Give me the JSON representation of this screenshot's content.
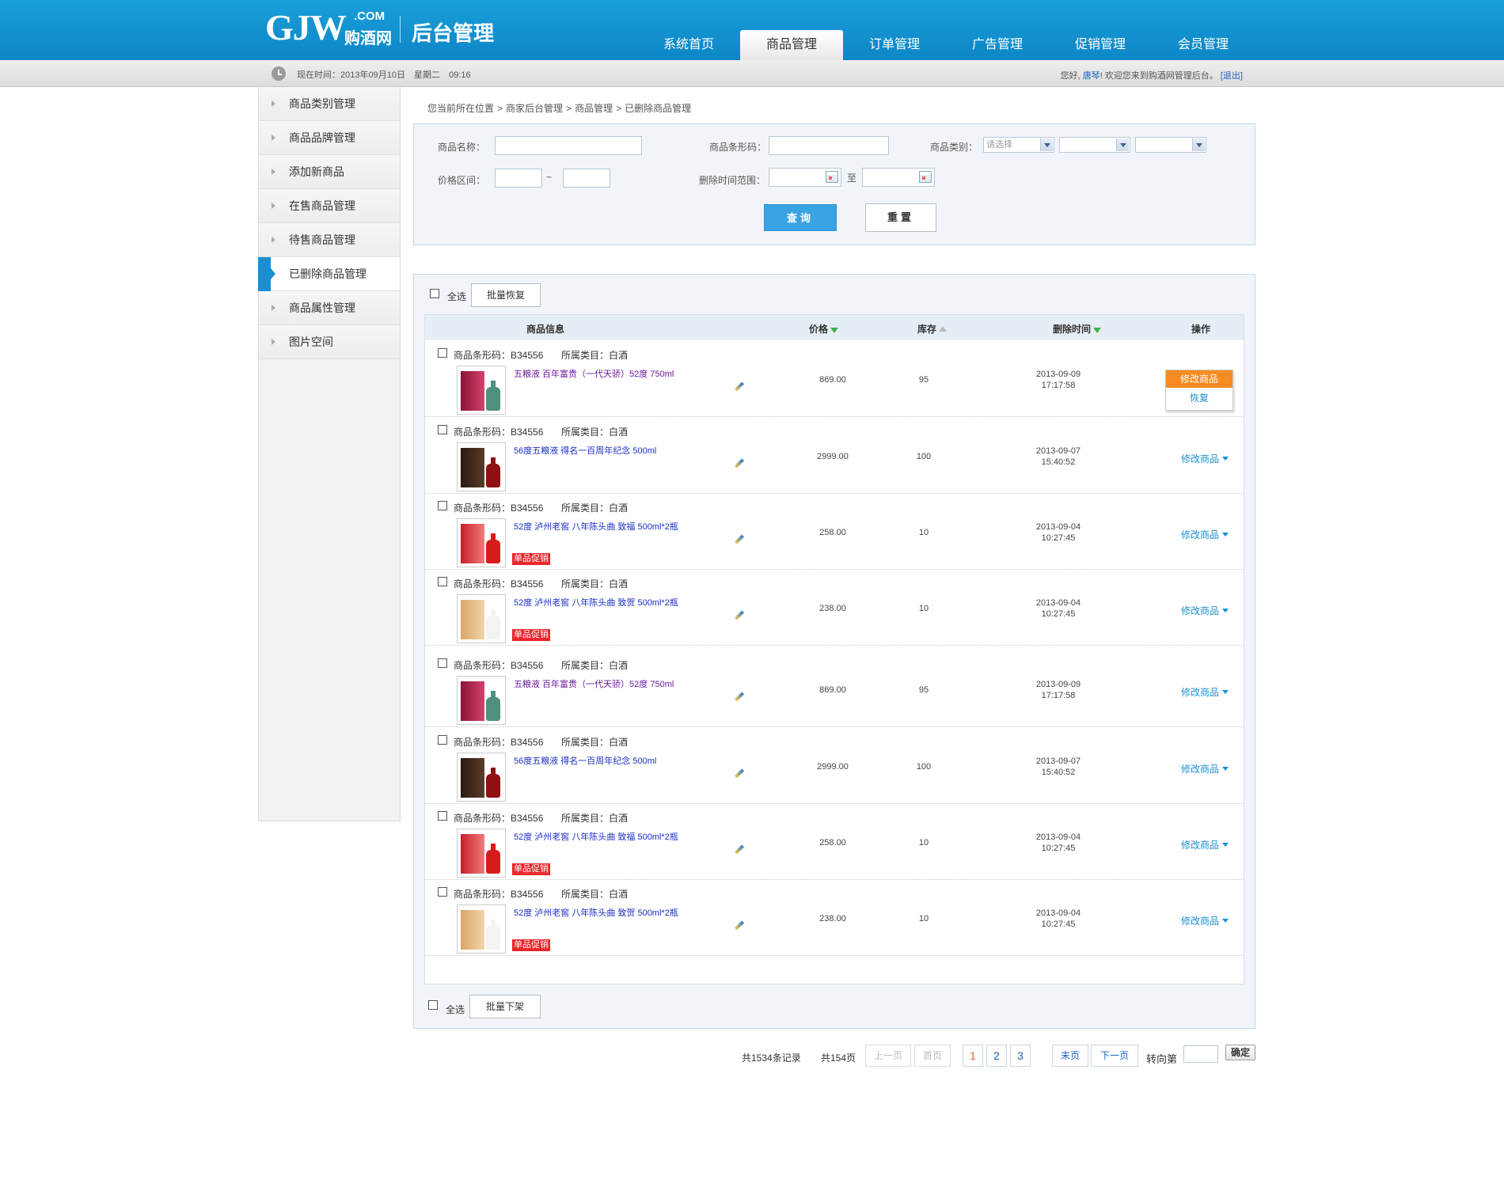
{
  "header": {
    "logo_text": "GJW",
    "logo_com": ".COM",
    "logo_cn": "购酒网",
    "admin_title": "后台管理",
    "nav": [
      {
        "label": "系统首页",
        "active": false
      },
      {
        "label": "商品管理",
        "active": true
      },
      {
        "label": "订单管理",
        "active": false
      },
      {
        "label": "广告管理",
        "active": false
      },
      {
        "label": "促销管理",
        "active": false
      },
      {
        "label": "会员管理",
        "active": false
      }
    ]
  },
  "subbar": {
    "time_label": "现在时间：2013年09月10日",
    "weekday": "星期二",
    "clock": "09:16",
    "greeting": "您好,",
    "username": "唐琴",
    "welcome": "! 欢迎您来到购酒网管理后台。",
    "logout": "[退出]"
  },
  "sidebar": {
    "items": [
      {
        "label": "商品类别管理",
        "active": false
      },
      {
        "label": "商品品牌管理",
        "active": false
      },
      {
        "label": "添加新商品",
        "active": false
      },
      {
        "label": "在售商品管理",
        "active": false
      },
      {
        "label": "待售商品管理",
        "active": false
      },
      {
        "label": "已删除商品管理",
        "active": true
      },
      {
        "label": "商品属性管理",
        "active": false
      },
      {
        "label": "图片空间",
        "active": false
      }
    ]
  },
  "breadcrumb": [
    "您当前所在位置",
    ">",
    "商家后台管理",
    ">",
    "商品管理",
    ">",
    "已删除商品管理"
  ],
  "search": {
    "name_label": "商品名称：",
    "barcode_label": "商品条形码：",
    "category_label": "商品类别：",
    "category_placeholder": "请选择",
    "price_label": "价格区间：",
    "price_sep": "~",
    "deltime_label": "删除时间范围：",
    "deltime_sep": "至",
    "query_button": "查询",
    "reset_button": "重置"
  },
  "list": {
    "select_all": "全选",
    "batch_restore": "批量恢复",
    "batch_offshelf": "批量下架",
    "headers": {
      "info": "商品信息",
      "price": "价格",
      "stock": "库存",
      "deltime": "删除时间",
      "action": "操作"
    },
    "op_label": "修改商品",
    "op_menu_edit": "修改商品",
    "op_menu_restore": "恢复",
    "promo_label": "单品促销",
    "rows": [
      {
        "code": "商品条形码：B34556",
        "cat": "所属类目：白酒",
        "name": "五粮液 百年富贵（一代天骄）52度 750ml",
        "price": "869.00",
        "stock": "95",
        "date": "2013-09-09",
        "time": "17:17:58",
        "promo": false,
        "visited": true,
        "menu_open": true,
        "img": "wly-red"
      },
      {
        "code": "商品条形码：B34556",
        "cat": "所属类目：白酒",
        "name": "56度五粮液 得名一百周年纪念 500ml",
        "price": "2999.00",
        "stock": "100",
        "date": "2013-09-07",
        "time": "15:40:52",
        "promo": false,
        "visited": false,
        "menu_open": false,
        "img": "wly-dark"
      },
      {
        "code": "商品条形码：B34556",
        "cat": "所属类目：白酒",
        "name": "52度 泸州老窖 八年陈头曲 致福 500ml*2瓶",
        "price": "258.00",
        "stock": "10",
        "date": "2013-09-04",
        "time": "10:27:45",
        "promo": true,
        "visited": false,
        "menu_open": false,
        "img": "lzlj-red"
      },
      {
        "code": "商品条形码：B34556",
        "cat": "所属类目：白酒",
        "name": "52度 泸州老窖 八年陈头曲 致贺 500ml*2瓶",
        "price": "238.00",
        "stock": "10",
        "date": "2013-09-04",
        "time": "10:27:45",
        "promo": true,
        "visited": false,
        "menu_open": false,
        "img": "lzlj-gold"
      },
      {
        "code": "商品条形码：B34556",
        "cat": "所属类目：白酒",
        "name": "五粮液 百年富贵（一代天骄）52度 750ml",
        "price": "869.00",
        "stock": "95",
        "date": "2013-09-09",
        "time": "17:17:58",
        "promo": false,
        "visited": true,
        "menu_open": false,
        "img": "wly-red"
      },
      {
        "code": "商品条形码：B34556",
        "cat": "所属类目：白酒",
        "name": "56度五粮液 得名一百周年纪念 500ml",
        "price": "2999.00",
        "stock": "100",
        "date": "2013-09-07",
        "time": "15:40:52",
        "promo": false,
        "visited": false,
        "menu_open": false,
        "img": "wly-dark"
      },
      {
        "code": "商品条形码：B34556",
        "cat": "所属类目：白酒",
        "name": "52度 泸州老窖 八年陈头曲 致福 500ml*2瓶",
        "price": "258.00",
        "stock": "10",
        "date": "2013-09-04",
        "time": "10:27:45",
        "promo": true,
        "visited": false,
        "menu_open": false,
        "img": "lzlj-red"
      },
      {
        "code": "商品条形码：B34556",
        "cat": "所属类目：白酒",
        "name": "52度 泸州老窖 八年陈头曲 致贺 500ml*2瓶",
        "price": "238.00",
        "stock": "10",
        "date": "2013-09-04",
        "time": "10:27:45",
        "promo": true,
        "visited": false,
        "menu_open": false,
        "img": "lzlj-gold"
      }
    ]
  },
  "pager": {
    "total_records": "共1534条记录",
    "total_pages": "共154页",
    "prev": "上一页",
    "first": "首页",
    "pages": [
      "1",
      "2",
      "3"
    ],
    "current_page": "1",
    "last": "末页",
    "next": "下一页",
    "goto": "转向第",
    "confirm": "确定"
  },
  "colors": {
    "header_blue": "#1a9fd9",
    "accent_orange": "#f68c22",
    "promo_red": "#e8262b",
    "link_blue": "#1a8fd4"
  }
}
